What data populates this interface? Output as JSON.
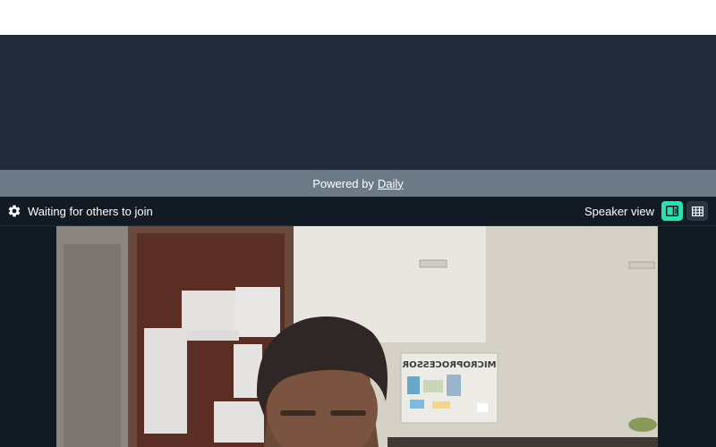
{
  "banner": {
    "powered_text": "Powered by",
    "powered_link": "Daily"
  },
  "toolbar": {
    "status": "Waiting for others to join",
    "view_label": "Speaker view",
    "icons": {
      "settings": "gear-icon",
      "speaker": "speaker-view-icon",
      "grid": "grid-view-icon"
    }
  },
  "video": {
    "poster_text": "MICROPROCESSOR"
  },
  "colors": {
    "dark_bg": "#222b39",
    "powered_bar": "#6c7987",
    "call_bg": "#121a24",
    "accent": "#2be0b0"
  }
}
